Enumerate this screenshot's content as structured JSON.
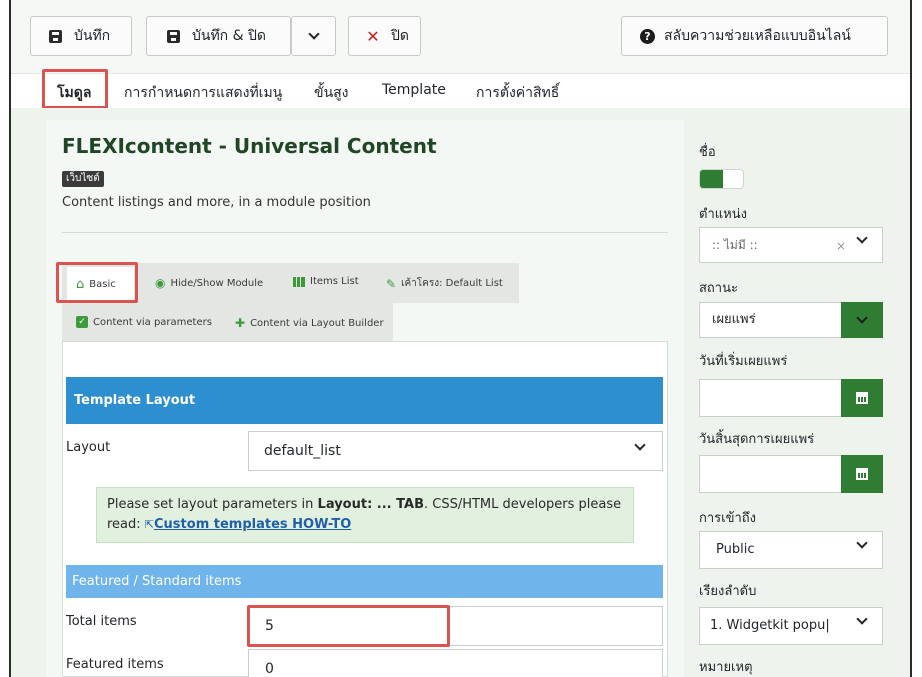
{
  "toolbar": {
    "save_label": "บันทึก",
    "save_close_label": "บันทึก & ปิด",
    "close_label": "ปิด",
    "help_label": "สลับความช่วยเหลือแบบอินไลน์"
  },
  "tabs": [
    {
      "label": "โมดูล",
      "active": true
    },
    {
      "label": "การกำหนดการแสดงที่เมนู"
    },
    {
      "label": "ขั้นสูง"
    },
    {
      "label": "Template"
    },
    {
      "label": "การตั้งค่าสิทธิ์"
    }
  ],
  "module": {
    "title": "FLEXIcontent - Universal Content",
    "badge": "เว็บไซต์",
    "description": "Content listings and more, in a module position"
  },
  "inner_tabs": [
    {
      "label": "Basic",
      "icon": "home-icon",
      "active": true
    },
    {
      "label": "Hide/Show Module",
      "icon": "eye-icon"
    },
    {
      "label": "Items List",
      "icon": "grid-icon"
    },
    {
      "label": "เค้าโครง: Default List",
      "icon": "brush-icon"
    },
    {
      "label": "Content via parameters",
      "icon": "check-icon"
    },
    {
      "label": "Content via Layout Builder",
      "icon": "puzzle-icon"
    }
  ],
  "template_layout": {
    "header": "Template Layout",
    "layout_label": "Layout",
    "layout_value": "default_list",
    "info_pre": "Please set layout parameters in ",
    "info_bold": "Layout: ... TAB",
    "info_post": ". CSS/HTML developers please read: ",
    "info_link": "Custom templates HOW-TO"
  },
  "featured": {
    "header": "Featured / Standard items",
    "total_label": "Total items",
    "total_value": "5",
    "featured_label": "Featured items",
    "featured_value": "0"
  },
  "sidebar": {
    "name_label": "ชื่อ",
    "position_label": "ตำแหน่ง",
    "position_value": ":: ไม่มี ::",
    "status_label": "สถานะ",
    "status_value": "เผยแพร่",
    "publish_up_label": "วันที่เริ่มเผยแพร่",
    "publish_down_label": "วันสิ้นสุดการเผยแพร่",
    "access_label": "การเข้าถึง",
    "access_value": "Public",
    "ordering_label": "เรียงลำดับ",
    "ordering_value": "1. Widgetkit popu|",
    "note_label": "หมายเหตุ"
  },
  "colors": {
    "accent_green": "#2e7d32",
    "header_blue": "#2d8fcf",
    "featured_blue": "#6fb5ec",
    "highlight_red": "#d9534f"
  }
}
